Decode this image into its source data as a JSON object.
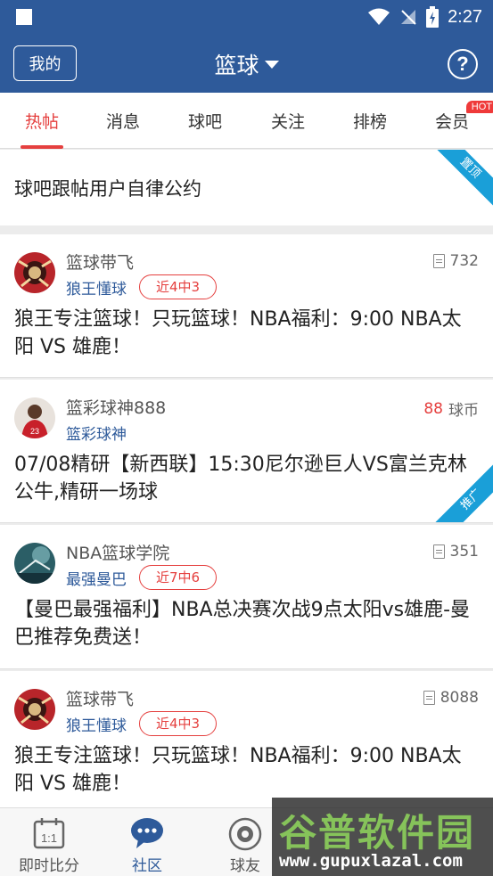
{
  "status_bar": {
    "time": "2:27"
  },
  "header": {
    "my_button": "我的",
    "title": "篮球",
    "help": "?"
  },
  "tabs": [
    {
      "label": "热帖",
      "active": true
    },
    {
      "label": "消息"
    },
    {
      "label": "球吧"
    },
    {
      "label": "关注"
    },
    {
      "label": "排榜"
    },
    {
      "label": "会员",
      "badge": "HOT"
    }
  ],
  "pinned": {
    "text": "球吧跟帖用户自律公约",
    "ribbon": "置顶"
  },
  "posts": [
    {
      "user": "篮球带飞",
      "tag": "狼王懂球",
      "record": "近4中3",
      "stat": "732",
      "text": "狼王专注篮球！只玩篮球！NBA福利：9:00 NBA太阳 VS 雄鹿！"
    },
    {
      "user": "篮彩球神888",
      "tag": "篮彩球神",
      "coins": "88",
      "coins_unit": "球币",
      "text": "07/08精研【新西联】15:30尼尔逊巨人VS富兰克林公牛,精研一场球",
      "ribbon": "推广"
    },
    {
      "user": "NBA篮球学院",
      "tag": "最强曼巴",
      "record": "近7中6",
      "stat": "351",
      "text": "【曼巴最强福利】NBA总决赛次战9点太阳vs雄鹿-曼巴推荐免费送！"
    },
    {
      "user": "篮球带飞",
      "tag": "狼王懂球",
      "record": "近4中3",
      "stat": "8088",
      "text": "狼王专注篮球！只玩篮球！NBA福利：9:00 NBA太阳 VS 雄鹿！"
    }
  ],
  "bottom_nav": [
    {
      "label": "即时比分",
      "icon": "calendar-score-icon"
    },
    {
      "label": "社区",
      "icon": "chat-bubble-icon",
      "active": true
    },
    {
      "label": "球友",
      "icon": "ball-friend-icon"
    }
  ],
  "watermark": {
    "big": "谷普软件园",
    "small": "www.gupuxlazal.com"
  },
  "colors": {
    "primary": "#2e5a9a",
    "accent": "#e5403f",
    "ribbon": "#1a9fd8"
  }
}
